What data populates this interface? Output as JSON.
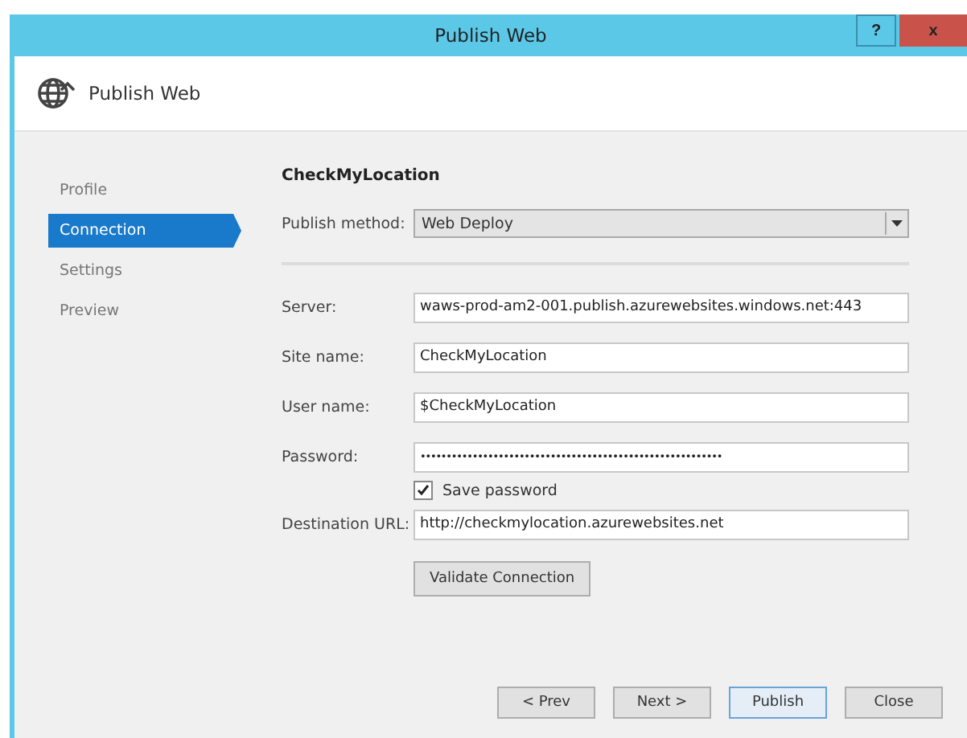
{
  "window": {
    "title": "Publish Web",
    "help": "?",
    "close": "x"
  },
  "header": {
    "title": "Publish Web"
  },
  "sidebar": {
    "items": [
      {
        "label": "Profile",
        "selected": false
      },
      {
        "label": "Connection",
        "selected": true
      },
      {
        "label": "Settings",
        "selected": false
      },
      {
        "label": "Preview",
        "selected": false
      }
    ]
  },
  "profile_name": "CheckMyLocation",
  "publish_method": {
    "label": "Publish method:",
    "value": "Web Deploy"
  },
  "fields": [
    {
      "label": "Server:",
      "value": "waws-prod-am2-001.publish.azurewebsites.windows.net:443"
    },
    {
      "label": "Site name:",
      "value": "CheckMyLocation"
    },
    {
      "label": "User name:",
      "value": "$CheckMyLocation"
    },
    {
      "label": "Password:",
      "value": "••••••••••••••••••••••••••••••••••••••••••••••••••••••••••"
    }
  ],
  "save_password": {
    "label": "Save password",
    "checked": true
  },
  "destination_url": {
    "label": "Destination URL:",
    "value": "http://checkmylocation.azurewebsites.net"
  },
  "validate_button": "Validate Connection",
  "buttons": [
    {
      "label": "< Prev",
      "default": false
    },
    {
      "label": "Next >",
      "default": false
    },
    {
      "label": "Publish",
      "default": true
    },
    {
      "label": "Close",
      "default": false
    }
  ]
}
